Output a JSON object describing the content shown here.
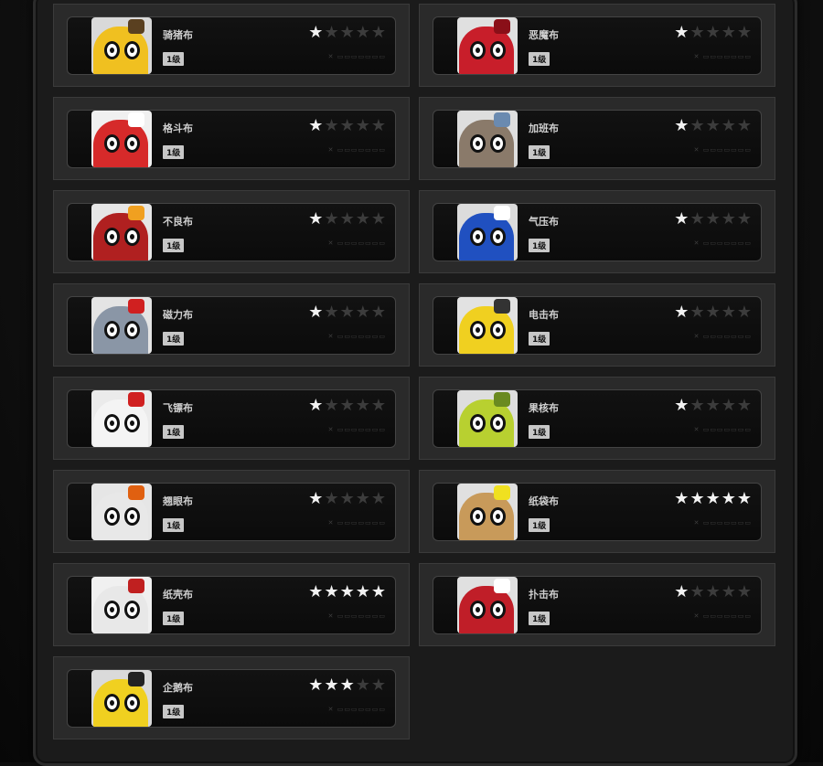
{
  "max_stars": 5,
  "cards": [
    {
      "name": "骑猪布",
      "level": "1级",
      "stars": 1,
      "exp": "✕ ▭▭▭▭▭▭▭",
      "theme": {
        "body": "#f0c020",
        "bg": "#d9d9d9",
        "accent": "#5a4020"
      }
    },
    {
      "name": "恶魔布",
      "level": "1级",
      "stars": 1,
      "exp": "✕ ▭▭▭▭▭▭▭",
      "theme": {
        "body": "#c81e2a",
        "bg": "#e0e0e0",
        "accent": "#8a0f18"
      }
    },
    {
      "name": "格斗布",
      "level": "1级",
      "stars": 1,
      "exp": "✕ ▭▭▭▭▭▭▭",
      "theme": {
        "body": "#d62a2a",
        "bg": "#f0f0f0",
        "accent": "#ffffff"
      }
    },
    {
      "name": "加班布",
      "level": "1级",
      "stars": 1,
      "exp": "✕ ▭▭▭▭▭▭▭",
      "theme": {
        "body": "#8a7a6a",
        "bg": "#dedede",
        "accent": "#6a8ab0"
      }
    },
    {
      "name": "不良布",
      "level": "1级",
      "stars": 1,
      "exp": "✕ ▭▭▭▭▭▭▭",
      "theme": {
        "body": "#b02020",
        "bg": "#e6e6e6",
        "accent": "#f0a020"
      }
    },
    {
      "name": "气压布",
      "level": "1级",
      "stars": 1,
      "exp": "✕ ▭▭▭▭▭▭▭",
      "theme": {
        "body": "#2050c0",
        "bg": "#dcdcdc",
        "accent": "#ffffff"
      }
    },
    {
      "name": "磁力布",
      "level": "1级",
      "stars": 1,
      "exp": "✕ ▭▭▭▭▭▭▭",
      "theme": {
        "body": "#8a96a6",
        "bg": "#e4e4e4",
        "accent": "#d02020"
      }
    },
    {
      "name": "电击布",
      "level": "1级",
      "stars": 1,
      "exp": "✕ ▭▭▭▭▭▭▭",
      "theme": {
        "body": "#f0d020",
        "bg": "#e2e2e2",
        "accent": "#333333"
      }
    },
    {
      "name": "飞镖布",
      "level": "1级",
      "stars": 1,
      "exp": "✕ ▭▭▭▭▭▭▭",
      "theme": {
        "body": "#f4f4f4",
        "bg": "#ebebeb",
        "accent": "#d02020"
      }
    },
    {
      "name": "果核布",
      "level": "1级",
      "stars": 1,
      "exp": "✕ ▭▭▭▭▭▭▭",
      "theme": {
        "body": "#b8d030",
        "bg": "#dedede",
        "accent": "#6a8a20"
      }
    },
    {
      "name": "翘眼布",
      "level": "1级",
      "stars": 1,
      "exp": "✕ ▭▭▭▭▭▭▭",
      "theme": {
        "body": "#e8e8e8",
        "bg": "#e6e6e6",
        "accent": "#e06010"
      }
    },
    {
      "name": "纸袋布",
      "level": "1级",
      "stars": 5,
      "exp": "✕ ▭▭▭▭▭▭▭",
      "theme": {
        "body": "#c89a5a",
        "bg": "#e0e0e0",
        "accent": "#f0e020"
      }
    },
    {
      "name": "纸壳布",
      "level": "1级",
      "stars": 5,
      "exp": "✕ ▭▭▭▭▭▭▭",
      "theme": {
        "body": "#e8e8e8",
        "bg": "#f0f0f0",
        "accent": "#c02020"
      }
    },
    {
      "name": "扑击布",
      "level": "1级",
      "stars": 1,
      "exp": "✕ ▭▭▭▭▭▭▭",
      "theme": {
        "body": "#c01e28",
        "bg": "#e0e0e0",
        "accent": "#ffffff"
      }
    },
    {
      "name": "企鹅布",
      "level": "1级",
      "stars": 3,
      "exp": "✕ ▭▭▭▭▭▭▭",
      "theme": {
        "body": "#f0d020",
        "bg": "#dadada",
        "accent": "#222222"
      }
    }
  ]
}
